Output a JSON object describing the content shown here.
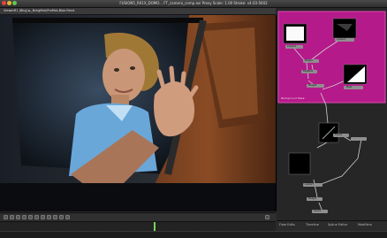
{
  "window": {
    "title": "FUSION5_R01X_DOMO...  FT_camera_comp.avi   Proxy Scale: 1.00   Stroke: v4.03-5602"
  },
  "viewer": {
    "label": "ViewerR1 (Bkg) ►_BckgMsk/ProMsk.Blok.Rend"
  },
  "flow": {
    "group_label": "Background Mask",
    "nodes": {
      "loader1": "Loader1",
      "loader2": "Loader2",
      "mask1": "Mask",
      "merge1": "Merge1",
      "bg_mask": "BkgMask",
      "merge2": "Merge2",
      "track1": "Track1",
      "loader3": "Loader3",
      "merge3": "Merge3",
      "saver1": "Saver1"
    },
    "colors": {
      "group_bg": "#b51a8a",
      "group_border": "#e04bb6",
      "node_fill": "#8f8f8f",
      "wire": "#cfcfcf"
    }
  },
  "flow_tabs": {
    "tab1": "Flow Edits",
    "tab2": "Timeline",
    "tab3": "Spline Editor",
    "tab4": "Modifiers"
  },
  "colors": {
    "accent_play": "#7bd15a",
    "viewer_bg": "#0d0f12",
    "window_bg": "#2a2a2a"
  }
}
